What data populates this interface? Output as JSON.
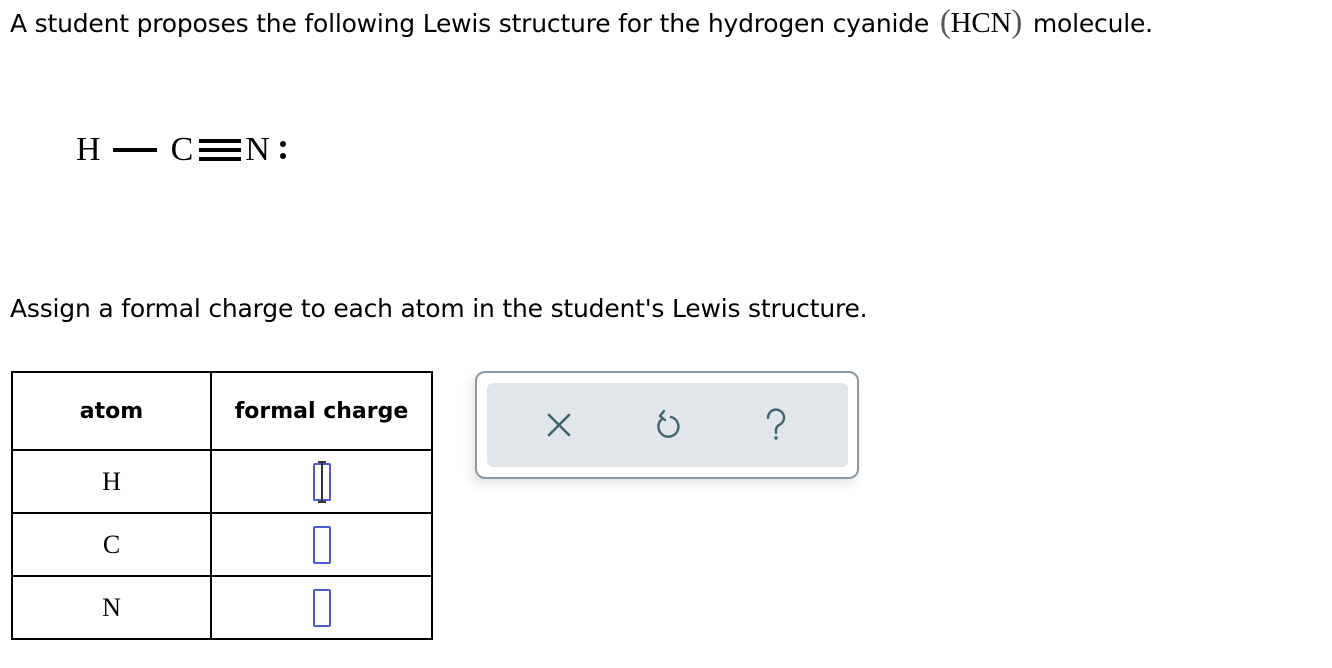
{
  "prompt": {
    "text_before": "A student proposes the following Lewis structure for the hydrogen cyanide",
    "formula": "HCN",
    "paren_open": "(",
    "paren_close": ")",
    "text_after": "molecule."
  },
  "lewis_structure": {
    "atoms": [
      "H",
      "C",
      "N"
    ],
    "bonds": [
      "single",
      "triple"
    ],
    "lone_pairs_on": "N",
    "lone_pair_glyph": ":"
  },
  "instruction": "Assign a formal charge to each atom in the student's Lewis structure.",
  "table": {
    "headers": [
      "atom",
      "formal charge"
    ],
    "rows": [
      {
        "atom": "H",
        "formal_charge": "",
        "active": true
      },
      {
        "atom": "C",
        "formal_charge": "",
        "active": false
      },
      {
        "atom": "N",
        "formal_charge": "",
        "active": false
      }
    ]
  },
  "toolbar": {
    "buttons": [
      {
        "name": "clear",
        "icon": "x-icon"
      },
      {
        "name": "undo",
        "icon": "undo-icon"
      },
      {
        "name": "help",
        "icon": "question-icon"
      }
    ],
    "icon_color": "#3f6470",
    "background": "#e1e6ea"
  },
  "colors": {
    "answer_box_border": "#4a5bd4",
    "toolbar_border": "#8a9aa0"
  }
}
